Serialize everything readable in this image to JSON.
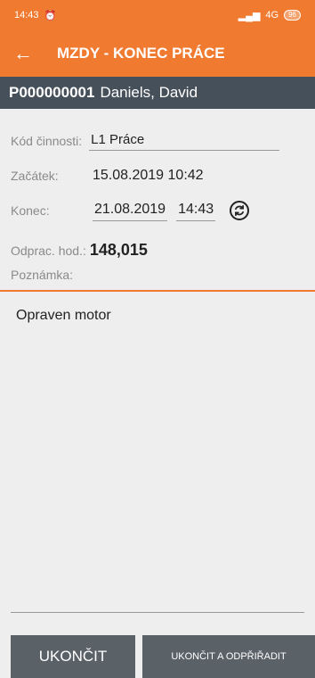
{
  "status_bar": {
    "time": "14:43",
    "network": "4G",
    "battery": "96"
  },
  "app_bar": {
    "back_icon": "←",
    "title": "MZDY - KONEC PRÁCE"
  },
  "employee": {
    "id": "P000000001",
    "name": "Daniels, David"
  },
  "form": {
    "activity_label": "Kód činnosti:",
    "activity_value": "L1 Práce",
    "start_label": "Začátek:",
    "start_value": "15.08.2019 10:42",
    "end_label": "Konec:",
    "end_date": "21.08.2019",
    "end_time": "14:43",
    "hours_label": "Odprac. hod.:",
    "hours_value": "148,015",
    "note_label": "Poznámka:",
    "note_value": "Opraven motor"
  },
  "buttons": {
    "finish": "UKONČIT",
    "finish_unassign": "UKONČIT A ODPŘIŘADIT"
  }
}
